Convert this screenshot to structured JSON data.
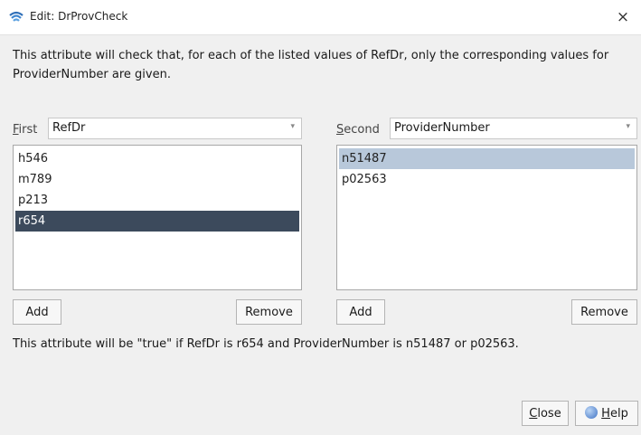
{
  "window": {
    "title": "Edit: DrProvCheck",
    "close_glyph": "×",
    "app_icon": "wifi-logo-icon"
  },
  "description": "This attribute will check that, for each of the listed values of RefDr, only the corresponding values for ProviderNumber are given.",
  "first": {
    "label_mnemonic": "F",
    "label_rest": "irst",
    "selected": "RefDr",
    "items": [
      "h546",
      "m789",
      "p213",
      "r654"
    ],
    "selected_index": 3,
    "add_label": "Add",
    "remove_label": "Remove"
  },
  "second": {
    "label_mnemonic": "S",
    "label_rest": "econd",
    "selected": "ProviderNumber",
    "items": [
      "n51487",
      "p02563"
    ],
    "selected_index": 0,
    "add_label": "Add",
    "remove_label": "Remove"
  },
  "info_text": "This attribute will be \"true\" if RefDr is r654 and ProviderNumber is n51487 or p02563.",
  "footer": {
    "close_mnemonic": "C",
    "close_rest": "lose",
    "help_mnemonic": "H",
    "help_rest": "elp"
  },
  "colors": {
    "selection_dark": "#3c4a5c",
    "selection_light": "#b8c8da"
  }
}
